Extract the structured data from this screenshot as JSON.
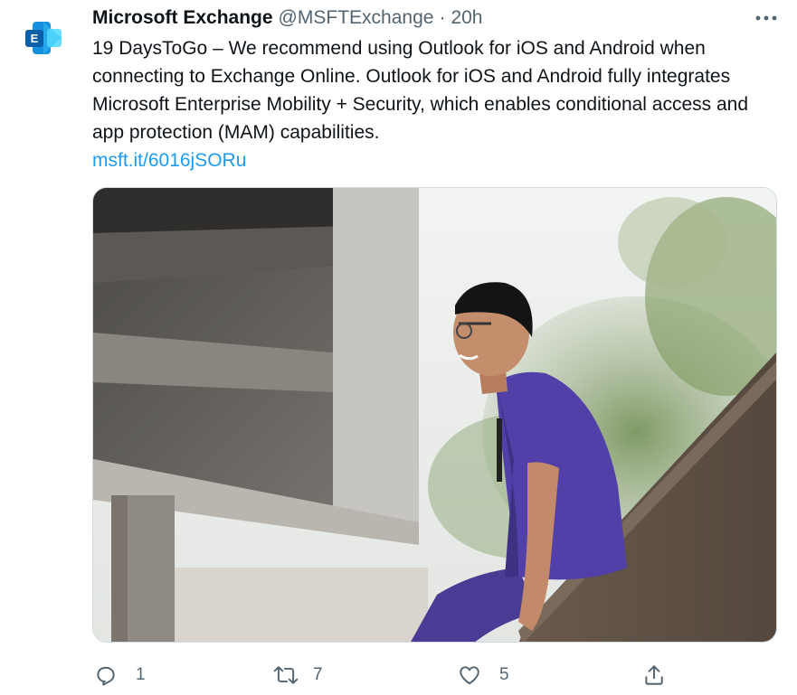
{
  "account": {
    "name": "Microsoft Exchange",
    "handle": "@MSFTExchange",
    "separator": "·",
    "time": "20h",
    "avatar_letter": "E"
  },
  "tweet": {
    "text": "19 DaysToGo – We recommend using Outlook for iOS and Android when connecting to Exchange Online. Outlook for iOS and Android fully integrates Microsoft Enterprise Mobility + Security, which enables conditional access and app protection (MAM) capabilities.",
    "link": "msft.it/6016jSORu"
  },
  "actions": {
    "reply_count": "1",
    "retweet_count": "7",
    "like_count": "5"
  },
  "icons": {
    "more": "more-options-icon",
    "reply": "reply-icon",
    "retweet": "retweet-icon",
    "like": "like-icon",
    "share": "share-icon"
  },
  "colors": {
    "link": "#1d9bf0",
    "secondary_text": "#536471",
    "scrubs": "#4a3b94"
  }
}
